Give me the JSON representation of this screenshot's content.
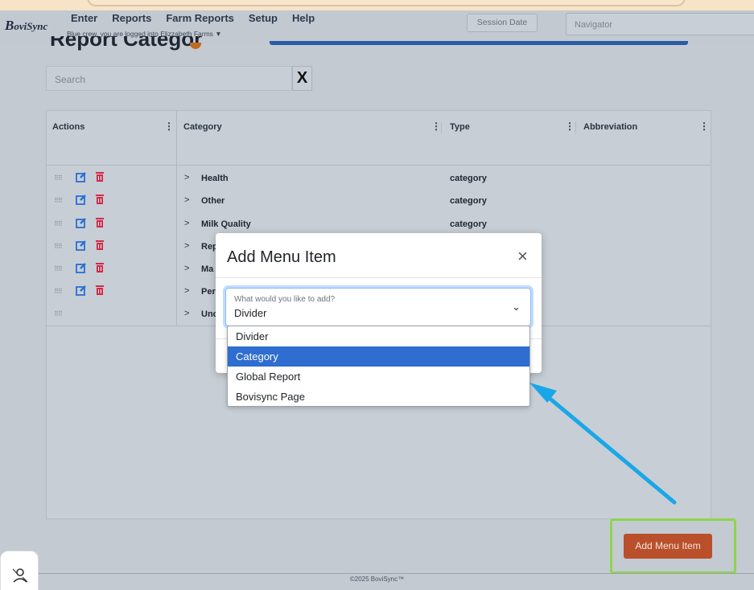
{
  "logo": {
    "text_b": "B",
    "text_rest": "oviSync"
  },
  "nav": {
    "items": [
      "Enter",
      "Reports",
      "Farm Reports",
      "Setup",
      "Help"
    ],
    "login_status": "Blue crew, you are logged into Elizzabeth Farms ▼",
    "session_button": "Session Date",
    "navigator_placeholder": "Navigator"
  },
  "page": {
    "title": "Report Categories"
  },
  "search": {
    "placeholder": "Search",
    "clear_label": "X"
  },
  "table": {
    "headers": [
      "Actions",
      "Category",
      "Type",
      "Abbreviation"
    ],
    "rows": [
      {
        "category": "Health",
        "type": "category",
        "editable": true
      },
      {
        "category": "Other",
        "type": "category",
        "editable": true
      },
      {
        "category": "Milk Quality",
        "type": "category",
        "editable": true
      },
      {
        "category": "Rep",
        "type": "",
        "editable": true
      },
      {
        "category": "Ma",
        "type": "",
        "editable": true
      },
      {
        "category": "Per",
        "type": "",
        "editable": true
      },
      {
        "category": "Unc",
        "type": "",
        "editable": false
      }
    ]
  },
  "modal": {
    "title": "Add Menu Item",
    "close_label": "×",
    "select_label": "What would you like to add?",
    "select_value": "Divider",
    "options": [
      "Divider",
      "Category",
      "Global Report",
      "Bovisync Page"
    ],
    "highlighted_option": "Category"
  },
  "add_button": {
    "label": "Add Menu Item"
  },
  "footer": {
    "copyright": "©2025 BoviSync™"
  },
  "colors": {
    "accent_blue": "#2f6dd0",
    "add_button": "#b9502b",
    "highlight_frame": "#8fd54a",
    "arrow": "#1aa7e8",
    "edit_icon": "#2a6fd6",
    "trash_icon": "#d3294a"
  }
}
